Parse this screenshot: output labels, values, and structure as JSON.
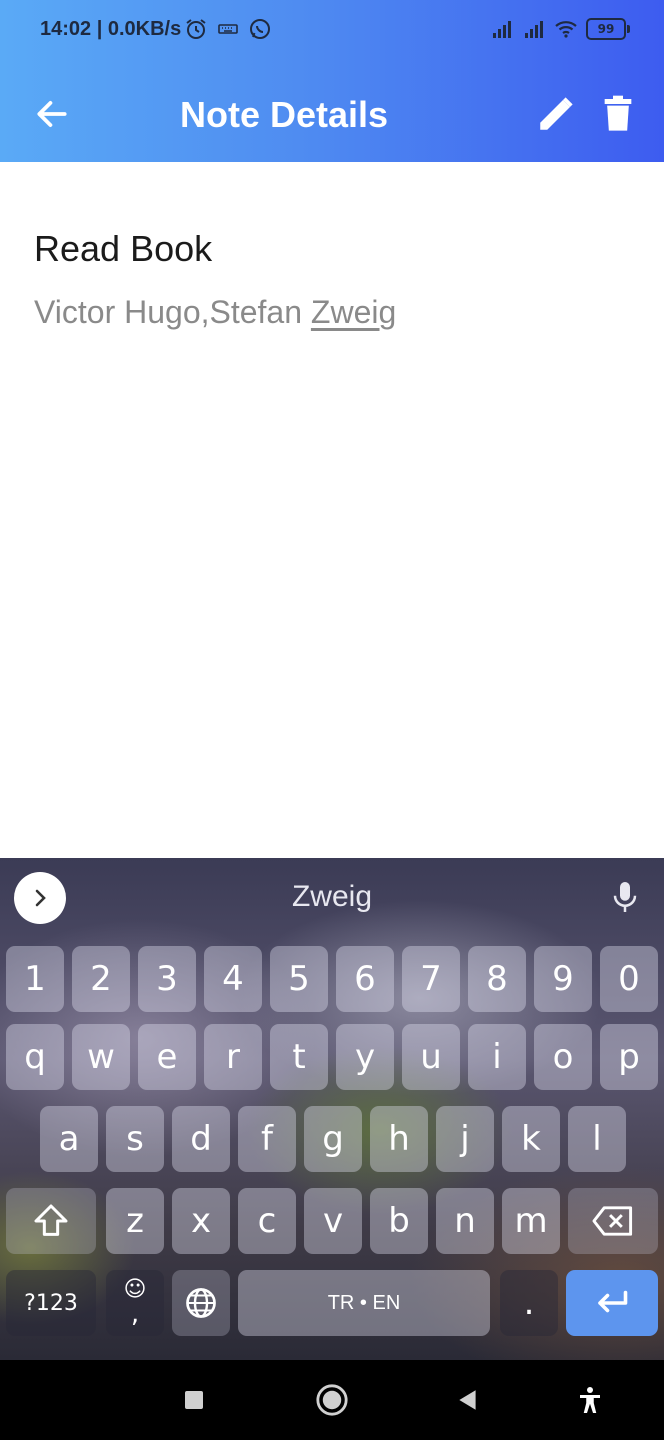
{
  "status_bar": {
    "time_speed": "14:02 | 0.0KB/s",
    "battery": "99",
    "icons": [
      "alarm-icon",
      "keyboard-icon",
      "whatsapp-icon",
      "signal-icon",
      "signal-icon",
      "wifi-icon",
      "battery-icon"
    ]
  },
  "app_bar": {
    "title": "Note Details",
    "back_icon": "arrow-left-icon",
    "edit_icon": "pencil-icon",
    "delete_icon": "trash-icon"
  },
  "note": {
    "title": "Read Book",
    "body_plain": "Victor Hugo,Stefan ",
    "body_underlined": "Zweig"
  },
  "keyboard": {
    "suggestion": "Zweig",
    "expand_icon": "chevron-right-icon",
    "mic_icon": "microphone-icon",
    "row_numbers": [
      "1",
      "2",
      "3",
      "4",
      "5",
      "6",
      "7",
      "8",
      "9",
      "0"
    ],
    "row1": [
      "q",
      "w",
      "e",
      "r",
      "t",
      "y",
      "u",
      "i",
      "o",
      "p"
    ],
    "row2": [
      "a",
      "s",
      "d",
      "f",
      "g",
      "h",
      "j",
      "k",
      "l"
    ],
    "row3": [
      "z",
      "x",
      "c",
      "v",
      "b",
      "n",
      "m"
    ],
    "symbols_key": "?123",
    "emoji_comma_top": "☺",
    "emoji_comma_bottom": ",",
    "space_label": "TR • EN",
    "period": ".",
    "shift_icon": "shift-icon",
    "backspace_icon": "backspace-icon",
    "globe_icon": "globe-icon",
    "enter_icon": "enter-icon",
    "enter_color": "#5d95ee"
  },
  "nav_bar": {
    "icons": [
      "square-icon",
      "home-circle-icon",
      "back-triangle-icon",
      "accessibility-icon"
    ]
  },
  "colors": {
    "header_start": "#5aaaf6",
    "header_end": "#3d5cf0",
    "note_title": "#1b1b1b",
    "note_body": "#8a8a8a"
  }
}
